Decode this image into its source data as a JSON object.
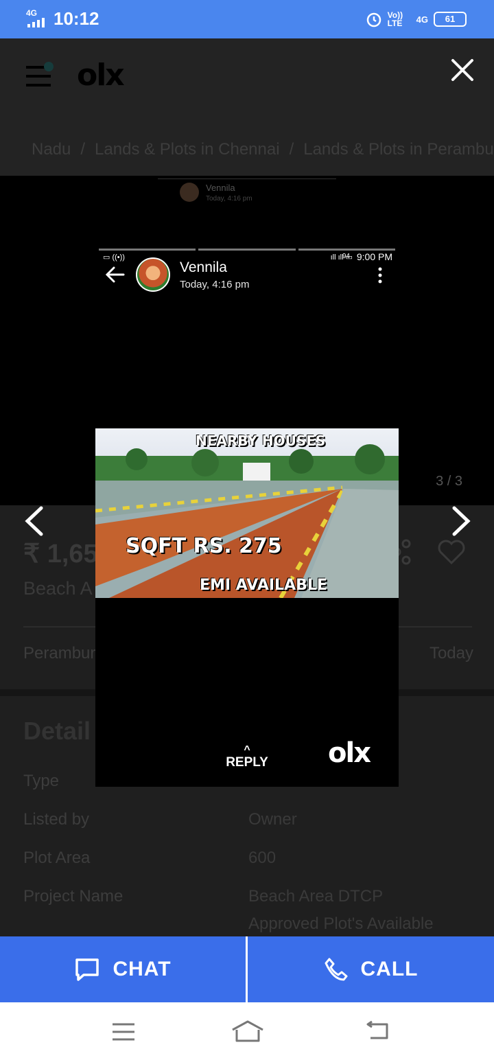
{
  "status_bar": {
    "network": "4G",
    "time": "10:12",
    "volte": "Vo)) LTE",
    "data_type": "4G",
    "battery": "61"
  },
  "header": {
    "logo": "olx"
  },
  "breadcrumb": {
    "items": [
      "Nadu",
      "Lands & Plots in Chennai",
      "Lands & Plots in Perambur"
    ],
    "separator": "/"
  },
  "gallery": {
    "counter": "3 / 3",
    "screenshot_header": {
      "contact_name": "Vennila",
      "timestamp": "Today, 4:16 pm",
      "status_time": "9:00 PM",
      "battery": "94"
    },
    "faint_header": {
      "contact_name": "Vennila",
      "timestamp": "Today, 4:16 pm"
    },
    "image_captions": {
      "top": "NEARBY HOUSES",
      "price": "SQFT RS. 275",
      "emi": "EMI AVAILABLE"
    },
    "reply_label": "REPLY",
    "watermark": "olx"
  },
  "listing": {
    "price_partial": "₹ 1,65",
    "title_partial": "Beach A",
    "location_partial": "Perambur",
    "posted": "Today"
  },
  "details": {
    "heading_partial": "Detail",
    "rows": [
      {
        "label": "Type",
        "value": ""
      },
      {
        "label": "Listed by",
        "value": "Owner"
      },
      {
        "label": "Plot Area",
        "value": "600"
      },
      {
        "label": "Project Name",
        "value": "Beach Area DTCP"
      },
      {
        "label": "",
        "value": "Approved Plot's Available"
      }
    ]
  },
  "actions": {
    "chat_label": "CHAT",
    "call_label": "CALL"
  },
  "colors": {
    "accent": "#3a6eea",
    "status_bar": "#4a86ee"
  }
}
